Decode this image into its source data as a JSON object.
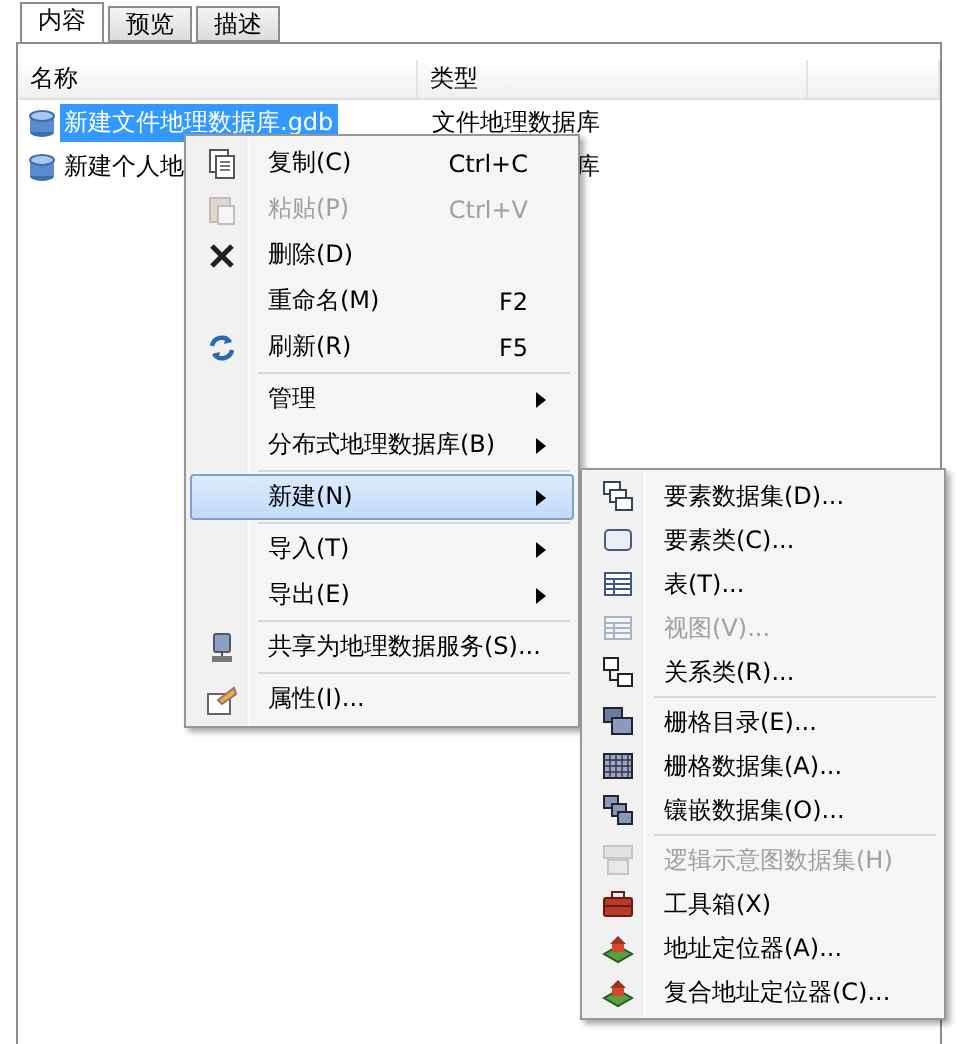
{
  "tabs": [
    {
      "label": "内容",
      "selected": true
    },
    {
      "label": "预览",
      "selected": false
    },
    {
      "label": "描述",
      "selected": false
    }
  ],
  "table": {
    "columns": [
      "名称",
      "类型"
    ],
    "rows": [
      {
        "name": "新建文件地理数据库.gdb",
        "type": "文件地理数据库",
        "selected": true
      },
      {
        "name": "新建个人地",
        "type": "库",
        "selected": false
      }
    ]
  },
  "context_menu": {
    "groups": [
      [
        {
          "kind": "copy",
          "label": "复制(C)",
          "shortcut": "Ctrl+C",
          "disabled": false,
          "submenu": false,
          "selected": false
        },
        {
          "kind": "paste",
          "label": "粘贴(P)",
          "shortcut": "Ctrl+V",
          "disabled": true,
          "submenu": false,
          "selected": false
        },
        {
          "kind": "delete",
          "label": "删除(D)",
          "disabled": false,
          "submenu": false,
          "selected": false
        },
        {
          "label": "重命名(M)",
          "shortcut": "F2",
          "disabled": false,
          "submenu": false,
          "selected": false
        },
        {
          "kind": "refresh",
          "label": "刷新(R)",
          "shortcut": "F5",
          "disabled": false,
          "submenu": false,
          "selected": false
        }
      ],
      [
        {
          "label": "管理",
          "disabled": false,
          "submenu": true,
          "selected": false
        },
        {
          "label": "分布式地理数据库(B)",
          "disabled": false,
          "submenu": true,
          "selected": false
        }
      ],
      [
        {
          "label": "新建(N)",
          "disabled": false,
          "submenu": true,
          "selected": true
        }
      ],
      [
        {
          "label": "导入(T)",
          "disabled": false,
          "submenu": true,
          "selected": false
        },
        {
          "label": "导出(E)",
          "disabled": false,
          "submenu": true,
          "selected": false
        }
      ],
      [
        {
          "kind": "share",
          "label": "共享为地理数据服务(S)...",
          "disabled": false,
          "submenu": false,
          "selected": false
        }
      ],
      [
        {
          "kind": "properties",
          "label": "属性(I)...",
          "disabled": false,
          "submenu": false,
          "selected": false
        }
      ]
    ]
  },
  "submenu": {
    "groups": [
      [
        {
          "kind": "dataset",
          "label": "要素数据集(D)...",
          "disabled": false
        },
        {
          "kind": "feature",
          "label": "要素类(C)...",
          "disabled": false
        },
        {
          "kind": "table",
          "label": "表(T)...",
          "disabled": false
        },
        {
          "kind": "table",
          "label": "视图(V)...",
          "disabled": true
        },
        {
          "kind": "relation",
          "label": "关系类(R)...",
          "disabled": false
        }
      ],
      [
        {
          "kind": "raster_catalog",
          "label": "栅格目录(E)...",
          "disabled": false
        },
        {
          "kind": "raster",
          "label": "栅格数据集(A)...",
          "disabled": false
        },
        {
          "kind": "mosaic",
          "label": "镶嵌数据集(O)...",
          "disabled": false
        }
      ],
      [
        {
          "kind": "schematic",
          "label": "逻辑示意图数据集(H)",
          "disabled": true
        },
        {
          "kind": "toolbox",
          "label": "工具箱(X)",
          "disabled": false
        },
        {
          "kind": "locator",
          "label": "地址定位器(A)...",
          "disabled": false
        },
        {
          "kind": "locator",
          "label": "复合地址定位器(C)...",
          "disabled": false
        }
      ]
    ]
  }
}
